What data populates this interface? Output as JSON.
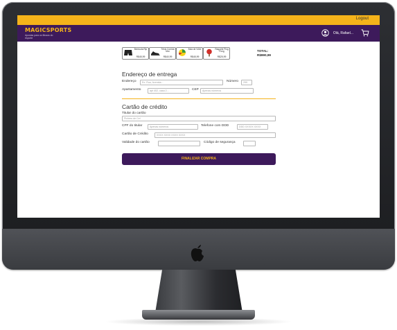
{
  "topbar": {
    "logout_label": "Logout"
  },
  "navbar": {
    "brand": "MAGICSPORTS",
    "tagline": "Apostas para os fãnaus do esporte",
    "greeting": "Olá, Rafael..."
  },
  "cart": {
    "items": [
      {
        "name": "Bermuda Rip",
        "price": "R$45,99",
        "icon": "shorts-icon"
      },
      {
        "name": "Tênis Corrida Mvc",
        "price": "R$40,99",
        "icon": "sneaker-icon"
      },
      {
        "name": "Bola de Vôlei",
        "price": "R$45,99",
        "icon": "volleyball-icon"
      },
      {
        "name": "Raquete Ping Pong",
        "price": "R$25,99",
        "icon": "paddle-icon"
      }
    ],
    "total_label": "TOTAL:",
    "total_value": "R$990,99"
  },
  "address": {
    "title": "Endereço de entrega",
    "endereco_label": "Endereço",
    "endereco_placeholder": "Ex: Rua, Avenida...",
    "numero_label": "Número",
    "numero_placeholder": "299",
    "apto_label": "Apartamento",
    "apto_placeholder": "apt 402, casa 2...",
    "cep_label": "CEP",
    "cep_placeholder": "Apenas números"
  },
  "card": {
    "title": "Cartão de crédito",
    "holder_label": "Titular do cartão",
    "holder_placeholder": "Pichero de Cel",
    "cpf_label": "CPF do titular",
    "cpf_placeholder": "Apenas números",
    "phone_label": "Telefone com DDD",
    "phone_placeholder": "DDD XXXXX XXXX",
    "card_label": "Cartão de Crédito",
    "card_placeholder": "XXXX XXXX XXXX XXXX",
    "validity_label": "Validade do cartão",
    "cvv_label": "Código de segurança"
  },
  "submit_label": "FINALIZAR COMPRA"
}
